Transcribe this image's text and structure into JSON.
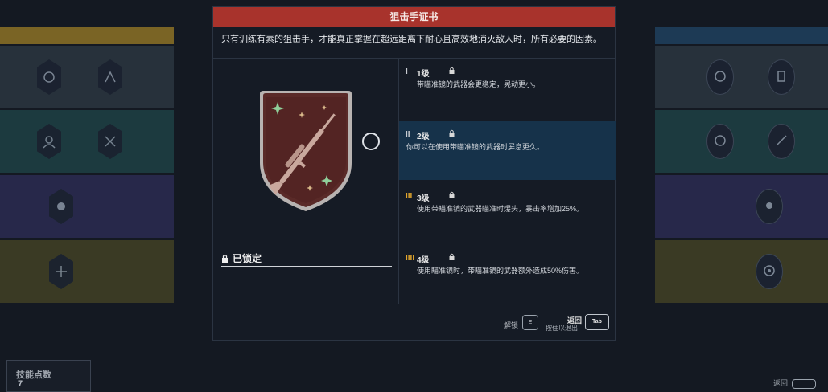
{
  "panel": {
    "title": "狙击手证书",
    "description": "只有训练有素的狙击手，才能真正掌握在超远距离下耐心且高效地消灭敌人时，所有必要的因素。",
    "lock_status": "已锁定",
    "badge_icon": "sniper-rifle-badge",
    "levels": [
      {
        "mark": "I",
        "name": "1级",
        "description": "带瞄准镜的武器会更稳定，晃动更小。",
        "mark_color": "#c8ccd2"
      },
      {
        "mark": "II",
        "name": "2级",
        "description": "你可以在使用带瞄准镜的武器时屏息更久。",
        "mark_color": "#c8ccd2"
      },
      {
        "mark": "III",
        "name": "3级",
        "description": "使用带瞄准镜的武器瞄准时爆头，暴击率增加25%。",
        "mark_color": "#e2a62d"
      },
      {
        "mark": "IIII",
        "name": "4级",
        "description": "使用瞄准镜时，带瞄准镜的武器额外造成50%伤害。",
        "mark_color": "#e2a62d"
      }
    ]
  },
  "footer": {
    "unlock_label": "解锁",
    "unlock_key": "E",
    "back_label": "返回",
    "hold_hint": "按住以退出",
    "back_key": "Tab"
  },
  "skill_points": {
    "label": "技能点数",
    "value": "7"
  },
  "bottom_right": {
    "label": "返回"
  },
  "colors": {
    "header_red": "#a8332c",
    "active_level": "#16324a",
    "tier_gold": "#e2a62d"
  }
}
